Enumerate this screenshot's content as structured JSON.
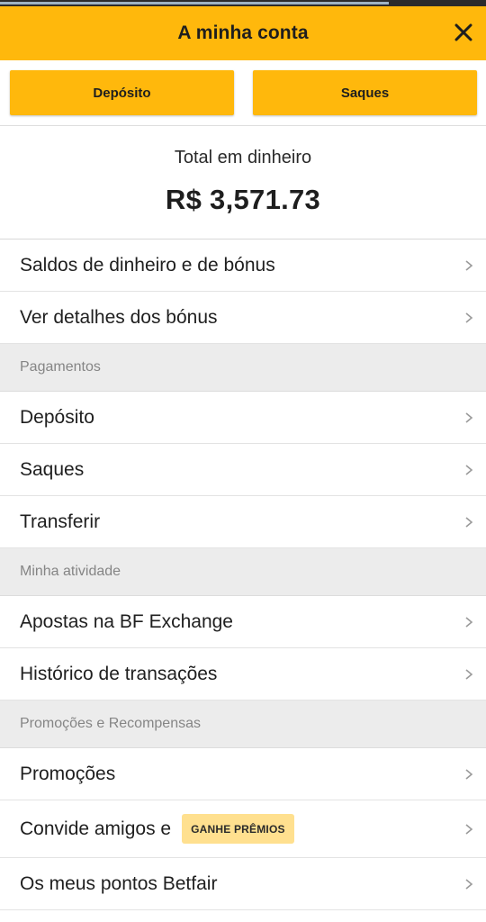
{
  "header": {
    "title": "A minha conta",
    "close_icon": "close-icon"
  },
  "actions": {
    "deposit_label": "Depósito",
    "withdraw_label": "Saques"
  },
  "balance": {
    "label": "Total em dinheiro",
    "value": "R$ 3,571.73"
  },
  "menu": {
    "top_items": [
      {
        "label": "Saldos de dinheiro e de bónus"
      },
      {
        "label": "Ver detalhes dos bónus"
      }
    ],
    "payments": {
      "title": "Pagamentos",
      "items": [
        {
          "label": "Depósito"
        },
        {
          "label": "Saques"
        },
        {
          "label": "Transferir"
        }
      ]
    },
    "activity": {
      "title": "Minha atividade",
      "items": [
        {
          "label": "Apostas na BF Exchange"
        },
        {
          "label": "Histórico de transações"
        }
      ]
    },
    "promotions": {
      "title": "Promoções e Recompensas",
      "items": [
        {
          "label": "Promoções"
        },
        {
          "label": "Convide amigos e",
          "badge": "GANHE PRÊMIOS"
        },
        {
          "label": "Os meus pontos Betfair"
        }
      ]
    }
  },
  "colors": {
    "brand": "#ffb80c",
    "badge": "#ffe08f",
    "section_bg": "#ececec"
  }
}
